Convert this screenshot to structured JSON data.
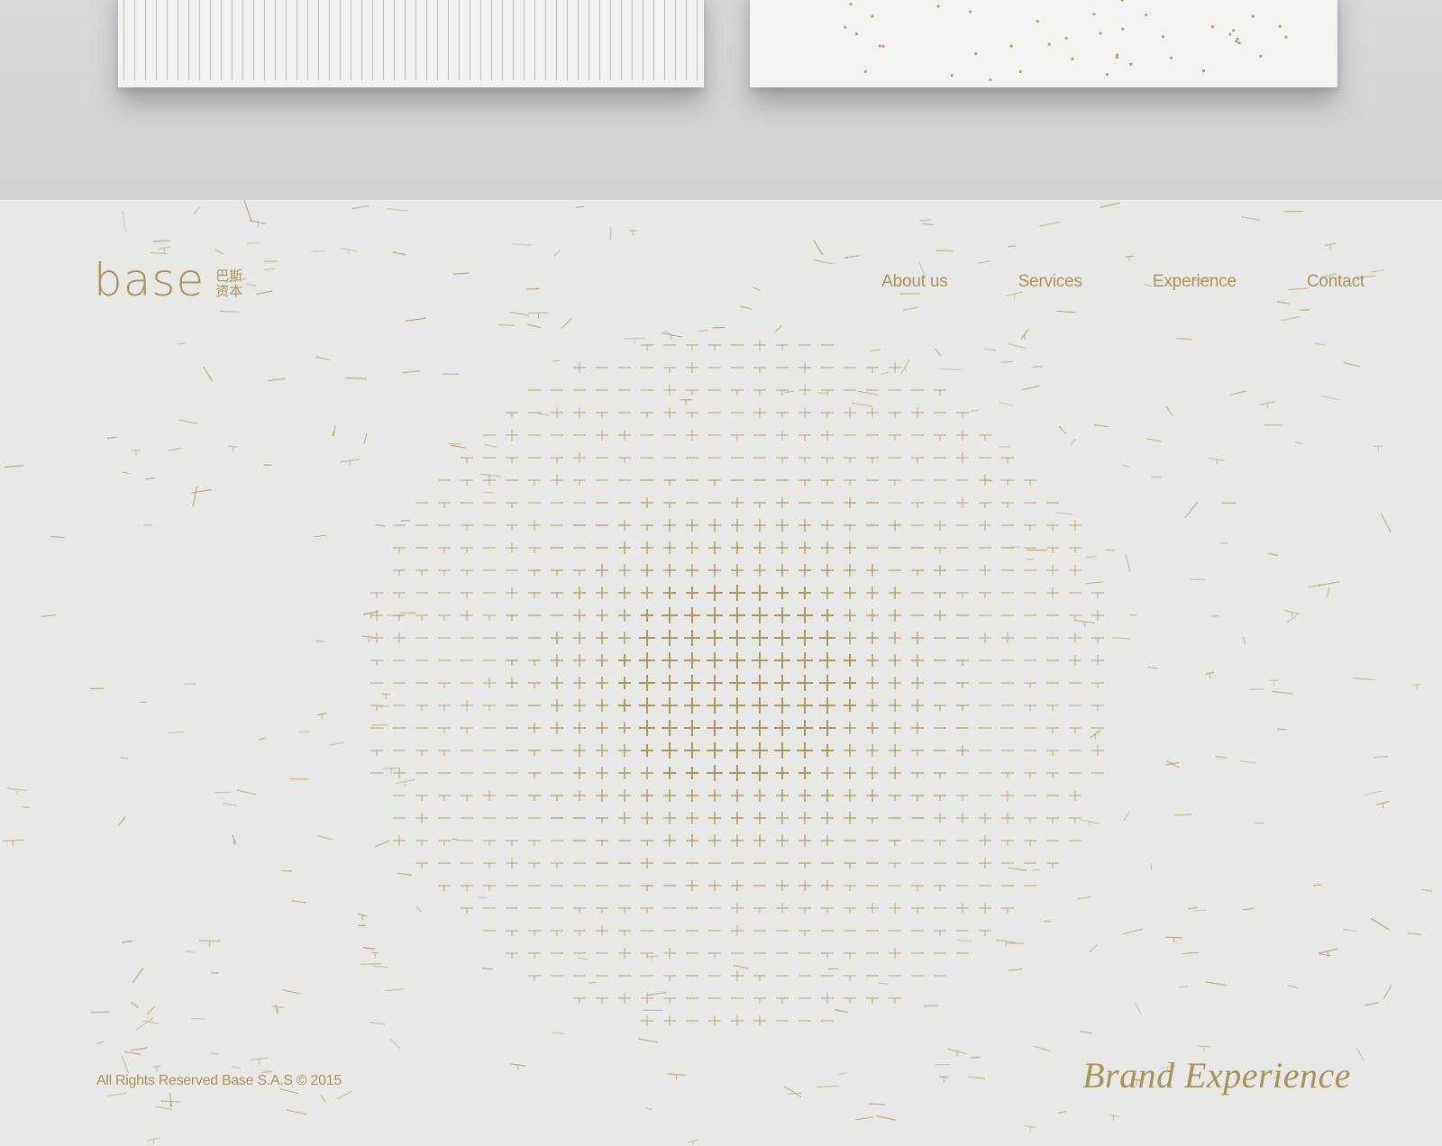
{
  "logo": {
    "wordmark": "base",
    "chinese_line_1": "巴斯",
    "chinese_line_2": "资本"
  },
  "nav": {
    "items": [
      {
        "label": "About us"
      },
      {
        "label": "Services"
      },
      {
        "label": "Experience"
      },
      {
        "label": "Contact"
      }
    ]
  },
  "footer": {
    "copyright": "All Rights Reserved Base S.A.S  © 2015"
  },
  "tagline": "Brand Experience",
  "colors": {
    "accent_gold": "#a8935a",
    "page_background": "#e8e8e6",
    "mockup_background": "#d6d6d8",
    "card_background": "#f3f3f1"
  },
  "decoration": {
    "pattern": "radial grid of cross marks dissolving into scattered dashes",
    "icon": "cross-mark-icon"
  }
}
